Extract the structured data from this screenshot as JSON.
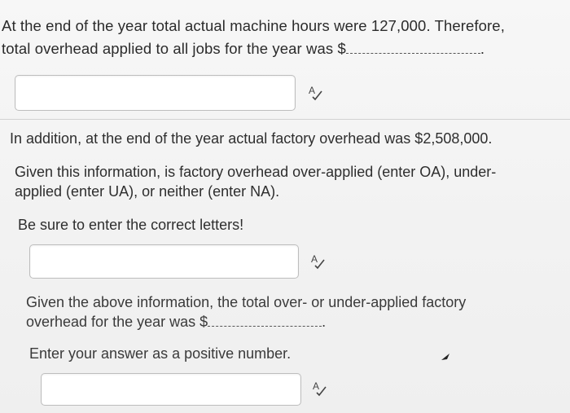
{
  "section1": {
    "text_line1": "At the end of the year total actual machine hours were 127,000. Therefore,",
    "text_line2_prefix": "total overhead applied to all jobs for the year was $",
    "text_line2_suffix": ".",
    "input_value": ""
  },
  "section2": {
    "line1": "In addition, at the end of the year actual factory overhead was $2,508,000.",
    "line2": "Given this information, is factory overhead over-applied (enter OA), under-",
    "line3": "applied (enter UA), or neither (enter NA).",
    "line4": "Be sure to enter the correct letters!",
    "input_value": ""
  },
  "section3": {
    "line1": "Given the above information, the total over- or under-applied factory",
    "line2_prefix": "overhead for the year was $",
    "line2_suffix": ".",
    "line3": "Enter your answer as a positive number.",
    "input_value": ""
  },
  "icons": {
    "spellcheck": "spellcheck-icon",
    "cursor": "mouse-cursor-icon"
  },
  "colors": {
    "background": "#f1f1f1",
    "text": "#2b2b2b",
    "input_border": "#bdbdbd"
  }
}
